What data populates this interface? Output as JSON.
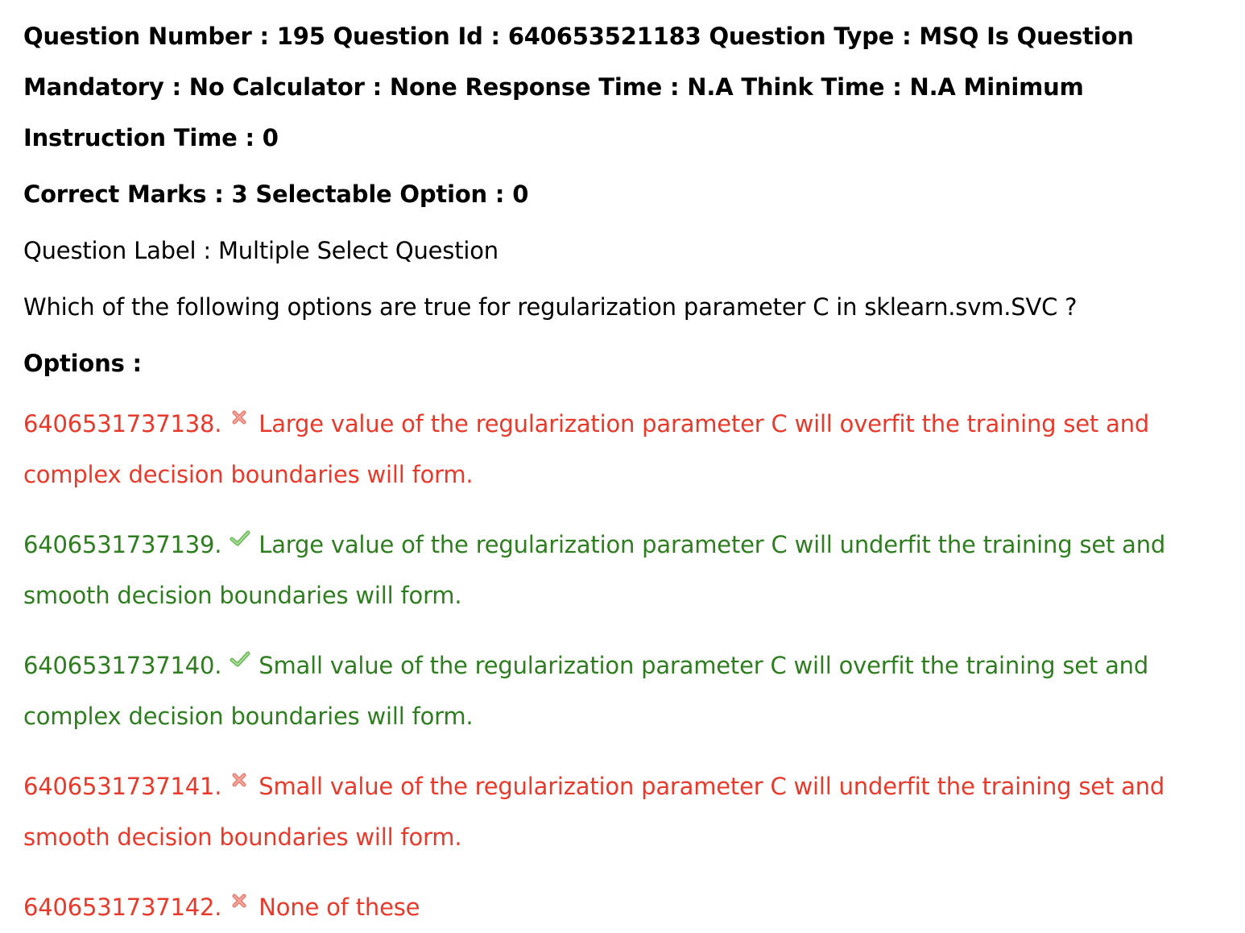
{
  "header": {
    "meta_line": "Question Number : 195 Question Id : 640653521183 Question Type : MSQ Is Question Mandatory : No Calculator : None Response Time : N.A Think Time : N.A Minimum Instruction Time : 0",
    "marks_line": "Correct Marks : 3 Selectable Option : 0"
  },
  "question": {
    "label_line": "Question Label : Multiple Select Question",
    "text": "Which of the following options are true for regularization parameter C in sklearn.svm.SVC ?",
    "options_heading": "Options :"
  },
  "options": [
    {
      "id": "6406531737138.",
      "text": "Large value of the regularization parameter C will overfit the training set and complex decision boundaries will form.",
      "status": "incorrect",
      "icon": "cross-icon",
      "color": "#e8392b"
    },
    {
      "id": "6406531737139.",
      "text": "Large value of the regularization parameter C will underfit the training set and smooth decision boundaries will form.",
      "status": "correct",
      "icon": "check-icon",
      "color": "#2e7d1f"
    },
    {
      "id": "6406531737140.",
      "text": "Small value of the regularization parameter C will overfit the training set and complex decision boundaries will form.",
      "status": "correct",
      "icon": "check-icon",
      "color": "#2e7d1f"
    },
    {
      "id": "6406531737141.",
      "text": "Small value of the regularization parameter C will underfit the training set and smooth decision boundaries will form.",
      "status": "incorrect",
      "icon": "cross-icon",
      "color": "#e8392b"
    },
    {
      "id": "6406531737142.",
      "text": "None of these",
      "status": "incorrect",
      "icon": "cross-icon",
      "color": "#e8392b"
    }
  ]
}
